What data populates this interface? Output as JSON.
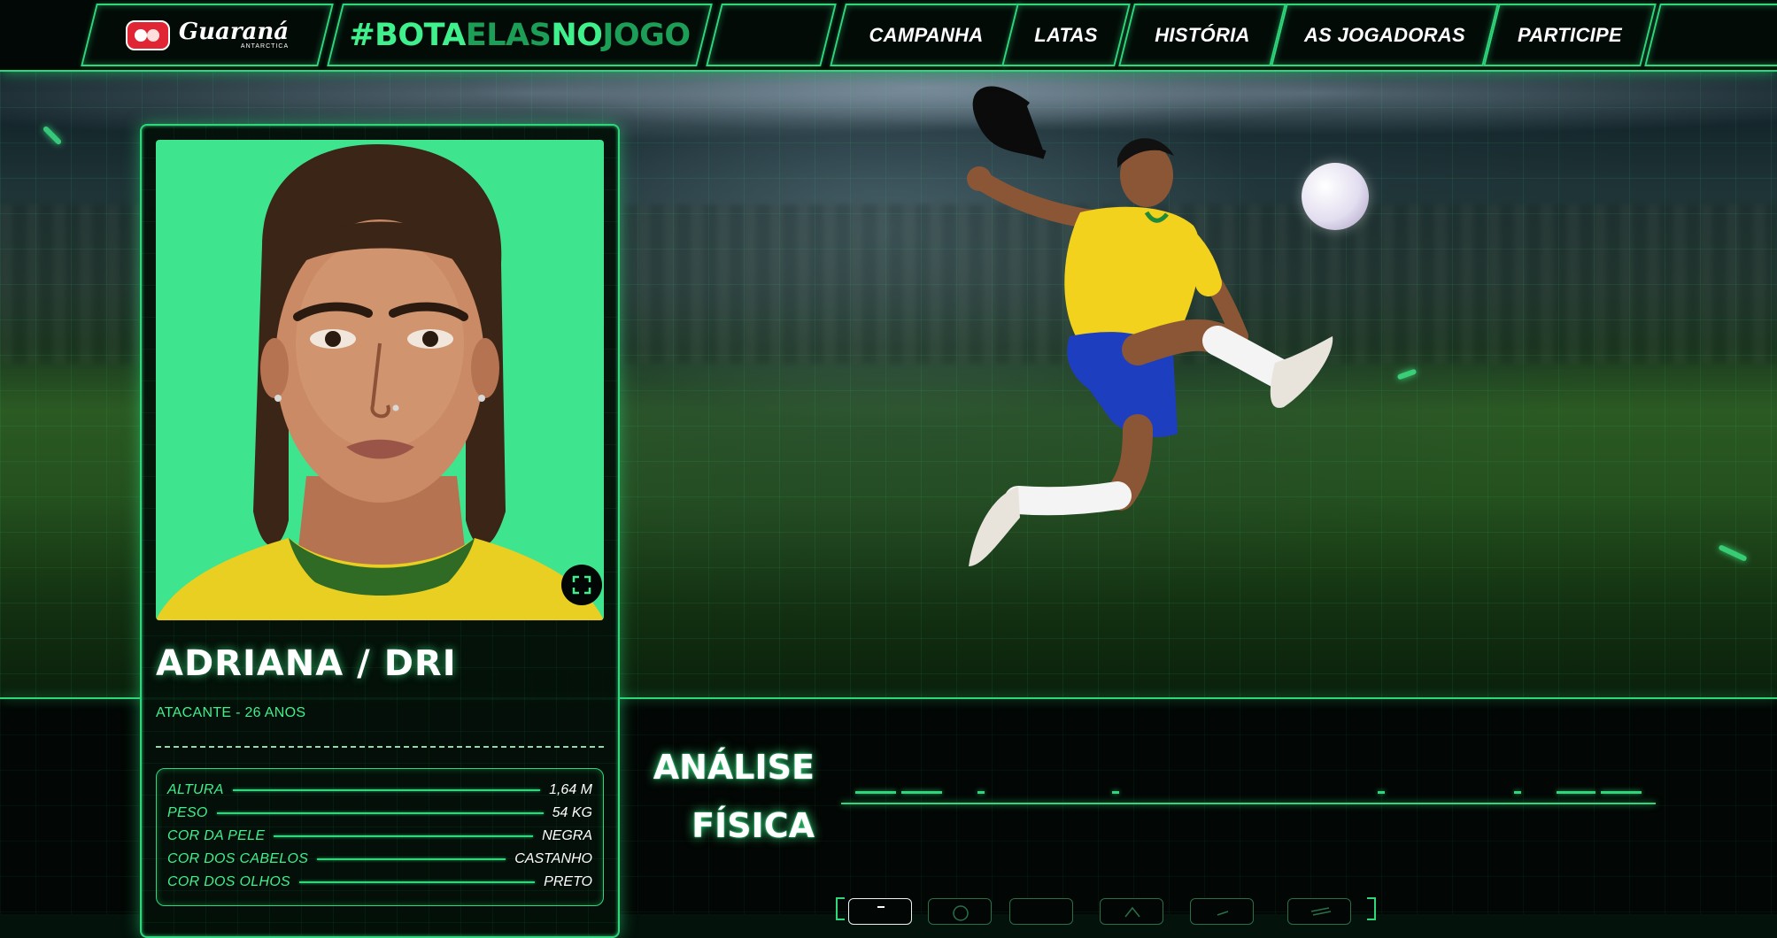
{
  "nav": {
    "logo": {
      "name": "Guaraná",
      "sub": "ANTARCTICA"
    },
    "hashtag": {
      "p1": "#BOTA",
      "p2": "ELAS",
      "p3": "NO",
      "p4": "JOGO"
    },
    "links": [
      {
        "label": "CAMPANHA"
      },
      {
        "label": "LATAS"
      },
      {
        "label": "HISTÓRIA"
      },
      {
        "label": "AS JOGADORAS"
      },
      {
        "label": "PARTICIPE"
      }
    ]
  },
  "player": {
    "name": "ADRIANA / DRI",
    "role": "ATACANTE - 26 ANOS",
    "stats": [
      {
        "label": "ALTURA",
        "value": "1,64 M"
      },
      {
        "label": "PESO",
        "value": "54 KG"
      },
      {
        "label": "COR DA PELE",
        "value": "NEGRA"
      },
      {
        "label": "COR DOS CABELOS",
        "value": "CASTANHO"
      },
      {
        "label": "COR DOS OLHOS",
        "value": "PRETO"
      }
    ]
  },
  "analysis": {
    "line1": "ANÁLISE",
    "line2": "FÍSICA"
  },
  "icons": {
    "expand": "expand-icon",
    "tabs": [
      "body-tab-icon",
      "ball-tab-icon",
      "field-tab-icon",
      "kick-tab-icon",
      "run-tab-icon",
      "speed-tab-icon"
    ]
  },
  "colors": {
    "accent": "#2fd67b",
    "accent_bright": "#3ff08c",
    "portrait_bg": "#3fe48f",
    "background": "#020604"
  }
}
